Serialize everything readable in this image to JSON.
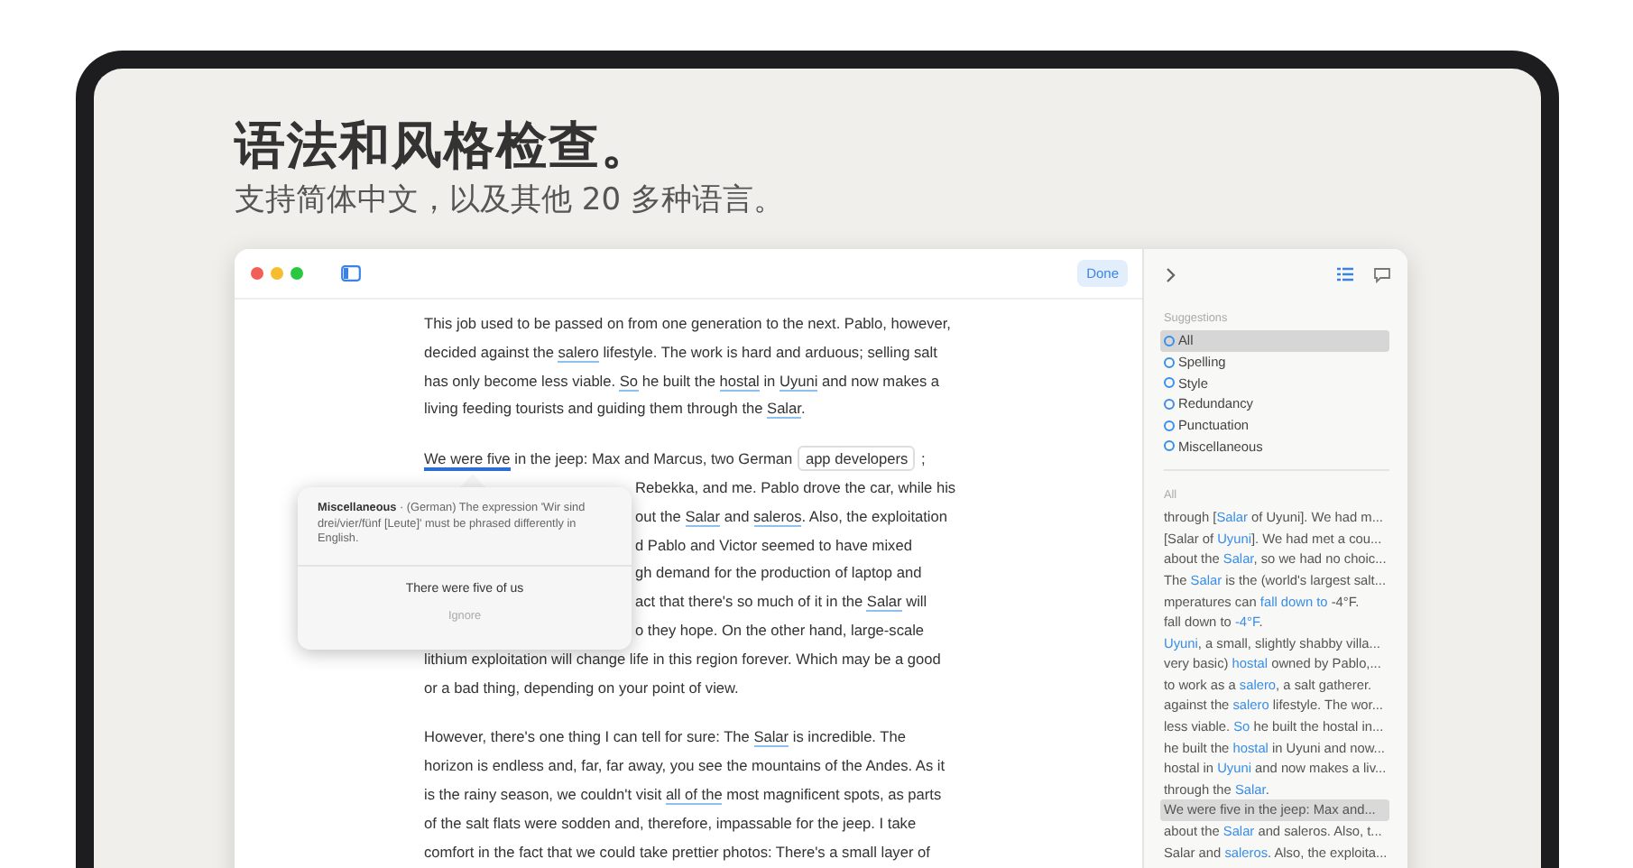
{
  "headline": {
    "title": "语法和风格检查。",
    "subtitle": "支持简体中文，以及其他 20 多种语言。"
  },
  "toolbar": {
    "done_button": "Done"
  },
  "document": {
    "paragraphs": [
      {
        "lines": [
          [
            {
              "text": "This job used to be passed on from one generation to the next. Pablo, however,",
              "kind": "plain"
            }
          ],
          [
            {
              "text": "decided against the ",
              "kind": "plain"
            },
            {
              "text": "salero",
              "kind": "flagged"
            },
            {
              "text": " lifestyle. The work is hard and arduous; selling salt",
              "kind": "plain"
            }
          ],
          [
            {
              "text": "has only become less viable. ",
              "kind": "plain"
            },
            {
              "text": "So",
              "kind": "flagged"
            },
            {
              "text": " he built the ",
              "kind": "plain"
            },
            {
              "text": "hostal",
              "kind": "flagged"
            },
            {
              "text": " in ",
              "kind": "plain"
            },
            {
              "text": "Uyuni",
              "kind": "flagged"
            },
            {
              "text": " and now makes a",
              "kind": "plain"
            }
          ],
          [
            {
              "text": "living feeding tourists and guiding them through the ",
              "kind": "plain"
            },
            {
              "text": "Salar",
              "kind": "flagged"
            },
            {
              "text": ".",
              "kind": "plain"
            }
          ]
        ]
      },
      {
        "lines": [
          [
            {
              "text": "We were five",
              "kind": "active"
            },
            {
              "text": " in the jeep: Max and Marcus, two German ",
              "kind": "plain"
            },
            {
              "text": "app developers",
              "kind": "boxed"
            },
            {
              "text": " ;",
              "kind": "plain"
            }
          ]
        ],
        "lines_beside_popup": [
          [
            {
              "text": "Rebekka, and me. Pablo drove the car, while his",
              "kind": "plain"
            }
          ],
          [
            {
              "text": "out the ",
              "kind": "plain"
            },
            {
              "text": "Salar",
              "kind": "flagged"
            },
            {
              "text": " and ",
              "kind": "plain"
            },
            {
              "text": "saleros",
              "kind": "flagged"
            },
            {
              "text": ". Also, the exploitation",
              "kind": "plain"
            }
          ],
          [
            {
              "text": "d Pablo and Victor seemed to have mixed",
              "kind": "plain"
            }
          ],
          [
            {
              "text": "gh demand for the production of laptop and",
              "kind": "plain"
            }
          ],
          [
            {
              "text": "act that there's so much of it in the ",
              "kind": "plain"
            },
            {
              "text": "Salar",
              "kind": "flagged"
            },
            {
              "text": " will",
              "kind": "plain"
            }
          ],
          [
            {
              "text": "o they hope. On the other hand, large-scale",
              "kind": "plain"
            }
          ]
        ],
        "lines_after_popup": [
          [
            {
              "text": "lithium exploitation will change life in this region forever. Which may be a good",
              "kind": "plain"
            }
          ],
          [
            {
              "text": "or a bad thing, depending on your point of view.",
              "kind": "plain"
            }
          ]
        ]
      },
      {
        "lines": [
          [
            {
              "text": "However, there's one thing I can tell for sure: The ",
              "kind": "plain"
            },
            {
              "text": "Salar",
              "kind": "flagged"
            },
            {
              "text": " is incredible. The",
              "kind": "plain"
            }
          ],
          [
            {
              "text": "horizon is endless and, far, far away, you see the mountains of the Andes. As it",
              "kind": "plain"
            }
          ],
          [
            {
              "text": "is the rainy season, we couldn't visit ",
              "kind": "plain"
            },
            {
              "text": "all of the",
              "kind": "flagged"
            },
            {
              "text": " most magnificent spots, as parts",
              "kind": "plain"
            }
          ],
          [
            {
              "text": "of the salt flats were sodden and, therefore, impassable for the jeep. I take",
              "kind": "plain"
            }
          ],
          [
            {
              "text": "comfort in the fact that we could take prettier photos: There's a small layer of",
              "kind": "plain"
            }
          ]
        ]
      }
    ]
  },
  "popup": {
    "message": "**Miscellaneous** · (German) The expression 'Wir sind drei/vier/fünf [Leute]' must be phrased differently in English.",
    "suggestion": "There were five of us",
    "ignore": "Ignore"
  },
  "sidebar": {
    "suggestions_label": "Suggestions",
    "categories": [
      {
        "label": "All",
        "selected": true
      },
      {
        "label": "Spelling",
        "selected": false
      },
      {
        "label": "Style",
        "selected": false
      },
      {
        "label": "Redundancy",
        "selected": false
      },
      {
        "label": "Punctuation",
        "selected": false
      },
      {
        "label": "Miscellaneous",
        "selected": false
      }
    ],
    "list_label": "All",
    "snippets": [
      {
        "selected": false,
        "before": "through [",
        "highlight": "Salar",
        "after": " of Uyuni]. We had m..."
      },
      {
        "selected": false,
        "before": "[Salar of ",
        "highlight": "Uyuni",
        "after": "]. We had met a cou..."
      },
      {
        "selected": false,
        "before": "about the ",
        "highlight": "Salar",
        "after": ", so we had no choic..."
      },
      {
        "selected": false,
        "before": "The ",
        "highlight": "Salar",
        "after": " is the (world's largest salt..."
      },
      {
        "selected": false,
        "before": "mperatures can ",
        "highlight": "fall down to",
        "after": " -4°F."
      },
      {
        "selected": false,
        "before": "fall down to ",
        "highlight": "-4°F",
        "after": "."
      },
      {
        "selected": false,
        "highlight": "Uyuni",
        "after": ", a small, slightly shabby villa..."
      },
      {
        "selected": false,
        "before": "very basic) ",
        "highlight": "hostal",
        "after": " owned by Pablo,..."
      },
      {
        "selected": false,
        "before": "to work as a ",
        "highlight": "salero",
        "after": ", a salt gatherer."
      },
      {
        "selected": false,
        "before": "against the ",
        "highlight": "salero",
        "after": " lifestyle. The wor..."
      },
      {
        "selected": false,
        "before": "less viable. ",
        "highlight": "So",
        "after": " he built the hostal in..."
      },
      {
        "selected": false,
        "before": "he built the ",
        "highlight": "hostal",
        "after": " in Uyuni and now..."
      },
      {
        "selected": false,
        "before": "hostal in ",
        "highlight": "Uyuni",
        "after": " and now makes a liv..."
      },
      {
        "selected": false,
        "before": "through the ",
        "highlight": "Salar",
        "after": "."
      },
      {
        "selected": true,
        "before": "We were five in the jeep: Max and..."
      },
      {
        "selected": false,
        "before": "about the ",
        "highlight": "Salar",
        "after": " and saleros. Also, t..."
      },
      {
        "selected": false,
        "before": "Salar and ",
        "highlight": "saleros",
        "after": ". Also, the exploita..."
      }
    ]
  }
}
